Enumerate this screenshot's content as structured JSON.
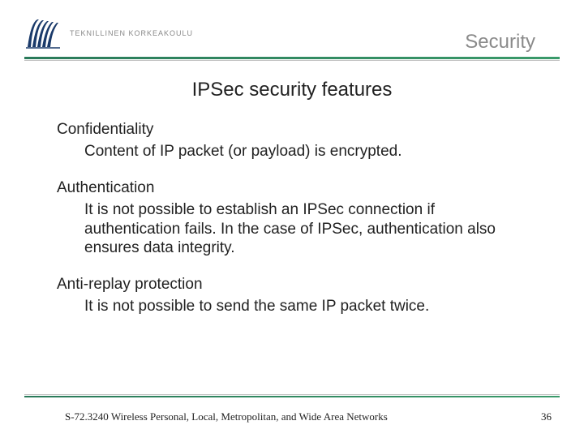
{
  "header": {
    "institution": "TEKNILLINEN KORKEAKOULU",
    "title": "Security"
  },
  "slide": {
    "title": "IPSec security features"
  },
  "sections": [
    {
      "head": "Confidentiality",
      "body": "Content of IP packet (or payload) is encrypted."
    },
    {
      "head": "Authentication",
      "body": "It is not possible to establish an IPSec connection if authentication fails. In the case of IPSec, authentication also ensures data integrity."
    },
    {
      "head": "Anti-replay protection",
      "body": "It is not possible to send the same IP packet twice."
    }
  ],
  "footer": {
    "course": "S-72.3240 Wireless Personal, Local, Metropolitan, and Wide Area Networks",
    "page": "36"
  }
}
